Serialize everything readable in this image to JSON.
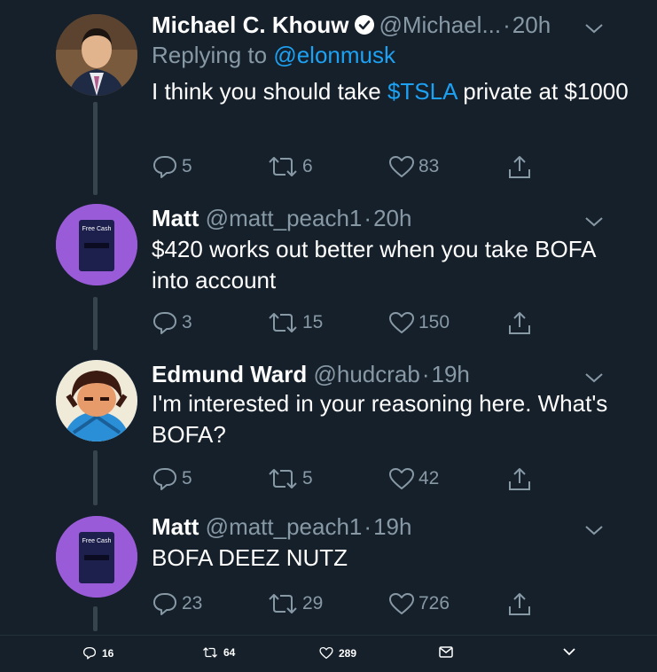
{
  "tweets": [
    {
      "name": "Michael C. Khouw",
      "verified": true,
      "handle": "@Michael...",
      "dot": "·",
      "time": "20h",
      "reply_prefix": "Replying to",
      "reply_mention": "@elonmusk",
      "body_pre": "I think you should take ",
      "cashtag": "$TSLA",
      "body_post": " private at $1000",
      "replies": "5",
      "retweets": "6",
      "likes": "83"
    },
    {
      "name": "Matt",
      "handle": "@matt_peach1",
      "dot": "·",
      "time": "20h",
      "body": "$420 works out better when you take BOFA into account",
      "avatar_text": "Free Cash",
      "replies": "3",
      "retweets": "15",
      "likes": "150"
    },
    {
      "name": "Edmund Ward",
      "handle": "@hudcrab",
      "dot": "·",
      "time": "19h",
      "body": "I'm interested in your reasoning here. What's BOFA?",
      "replies": "5",
      "retweets": "5",
      "likes": "42"
    },
    {
      "name": "Matt",
      "handle": "@matt_peach1",
      "dot": "·",
      "time": "19h",
      "body": "BOFA DEEZ NUTZ",
      "avatar_text": "Free Cash",
      "replies": "23",
      "retweets": "29",
      "likes": "726"
    }
  ],
  "bottom_bar": {
    "replies": "16",
    "retweets": "64",
    "likes": "289"
  },
  "colors": {
    "background": "#15202b",
    "secondary_text": "#8899a6",
    "accent": "#1da1f2"
  }
}
